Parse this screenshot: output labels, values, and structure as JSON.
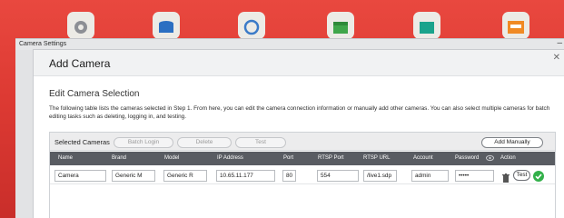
{
  "desktop": {
    "icons": [
      "settings-app-icon",
      "storage-app-icon",
      "network-app-icon",
      "calendar-app-icon",
      "files-app-icon",
      "store-app-icon"
    ]
  },
  "outer_window": {
    "title": "Camera Settings"
  },
  "dialog": {
    "title": "Add Camera",
    "section_title": "Edit Camera Selection",
    "description": "The following table lists the cameras selected in Step 1. From here, you can edit the camera connection information or manually add other cameras. You can also select multiple cameras for batch editing tasks such as deleting, logging in, and testing."
  },
  "panel": {
    "label": "Selected Cameras",
    "buttons": {
      "batch_login": "Batch Login",
      "delete": "Delete",
      "test": "Test",
      "add_manually": "Add Manually"
    }
  },
  "table": {
    "headers": [
      "Name",
      "Brand",
      "Model",
      "IP Address",
      "Port",
      "RTSP Port",
      "RTSP URL",
      "Account",
      "Password",
      "Action"
    ],
    "rows": [
      {
        "name": "Camera",
        "brand": "Generic M",
        "model": "Generic R",
        "ip": "10.65.11.177",
        "port": "80",
        "rtsp_port": "554",
        "rtsp_url": "/live1.sdp",
        "account": "admin",
        "password": "•••••",
        "test_label": "Test"
      }
    ]
  },
  "colors": {
    "accent_ok": "#33b04a",
    "table_header": "#595c62",
    "desktop_bg": "#e2433b"
  }
}
